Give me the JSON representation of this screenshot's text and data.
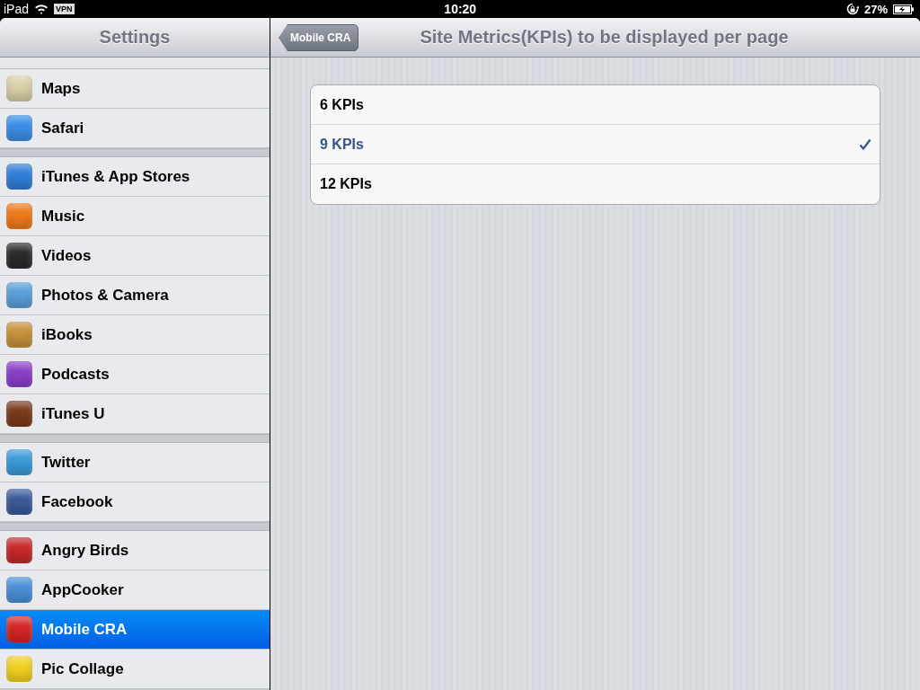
{
  "status_bar": {
    "device": "iPad",
    "vpn": "VPN",
    "time": "10:20",
    "battery": "27%"
  },
  "sidebar": {
    "title": "Settings",
    "groups": [
      {
        "items": [
          {
            "label": "Maps",
            "color": "#d9cfa8",
            "selected": false
          },
          {
            "label": "Safari",
            "color": "#3a8ee6",
            "selected": false
          }
        ]
      },
      {
        "items": [
          {
            "label": "iTunes & App Stores",
            "color": "#2f7fd8",
            "selected": false
          },
          {
            "label": "Music",
            "color": "#f07a1a",
            "selected": false
          },
          {
            "label": "Videos",
            "color": "#2b2b2b",
            "selected": false
          },
          {
            "label": "Photos & Camera",
            "color": "#5aa0d8",
            "selected": false
          },
          {
            "label": "iBooks",
            "color": "#c8913c",
            "selected": false
          },
          {
            "label": "Podcasts",
            "color": "#8a3fc8",
            "selected": false
          },
          {
            "label": "iTunes U",
            "color": "#7a3a1c",
            "selected": false
          }
        ]
      },
      {
        "items": [
          {
            "label": "Twitter",
            "color": "#3a9ad9",
            "selected": false
          },
          {
            "label": "Facebook",
            "color": "#3b5a9a",
            "selected": false
          }
        ]
      },
      {
        "items": [
          {
            "label": "Angry Birds",
            "color": "#c8282a",
            "selected": false
          },
          {
            "label": "AppCooker",
            "color": "#4a90d9",
            "selected": false
          },
          {
            "label": "Mobile CRA",
            "color": "#d42626",
            "selected": true
          },
          {
            "label": "Pic Collage",
            "color": "#f2d022",
            "selected": false
          }
        ]
      }
    ]
  },
  "detail": {
    "back_button": "Mobile CRA",
    "title": "Site Metrics(KPIs) to be displayed per page",
    "options": [
      {
        "label": "6 KPIs",
        "selected": false
      },
      {
        "label": "9 KPIs",
        "selected": true
      },
      {
        "label": "12 KPIs",
        "selected": false
      }
    ]
  }
}
